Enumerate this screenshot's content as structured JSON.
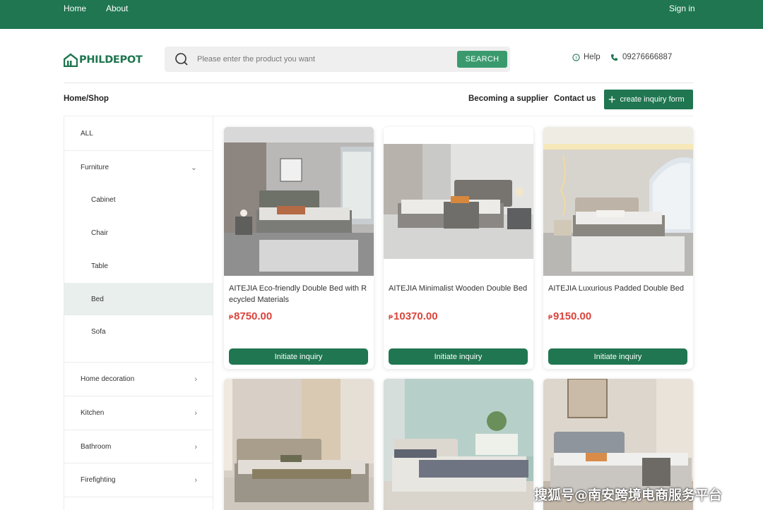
{
  "topbar": {
    "home": "Home",
    "about": "About",
    "sign_in": "Sign in"
  },
  "brand": {
    "logo_text": "PHILDEPOT",
    "color": "#1f7650"
  },
  "search": {
    "placeholder": "Please enter the product you want",
    "value": "",
    "button": "SEARCH"
  },
  "contact": {
    "help": "Help",
    "phone": "09276666887"
  },
  "breadcrumb": "Home/Shop",
  "nav": {
    "supplier": "Becoming a supplier",
    "contact_us": "Contact us",
    "inquiry_form": "create inquiry form"
  },
  "sidebar": {
    "items": [
      {
        "label": "ALL"
      },
      {
        "label": "Furniture",
        "expanded": true
      },
      {
        "label": "Cabinet"
      },
      {
        "label": "Chair"
      },
      {
        "label": "Table"
      },
      {
        "label": "Bed",
        "active": true
      },
      {
        "label": "Sofa"
      },
      {
        "label": "Home decoration"
      },
      {
        "label": "Kitchen"
      },
      {
        "label": "Bathroom"
      },
      {
        "label": "Firefighting"
      }
    ]
  },
  "products": [
    {
      "title": "AITEJIA Eco-friendly Double Bed with Recycled Materials",
      "currency": "₱",
      "price": "8750.00",
      "button": "Initiate inquiry"
    },
    {
      "title": "AITEJIA Minimalist Wooden Double Bed",
      "currency": "₱",
      "price": "10370.00",
      "button": "Initiate inquiry"
    },
    {
      "title": "AITEJIA Luxurious Padded Double Bed",
      "currency": "₱",
      "price": "9150.00",
      "button": "Initiate inquiry"
    },
    {
      "title": "",
      "currency": "",
      "price": "",
      "button": ""
    },
    {
      "title": "",
      "currency": "",
      "price": "",
      "button": ""
    },
    {
      "title": "",
      "currency": "",
      "price": "",
      "button": ""
    }
  ],
  "watermark": "搜狐号@南安跨境电商服务平台",
  "colors": {
    "primary": "#1f7650",
    "search_button": "#3a9a6e",
    "price": "#d9443b",
    "active_bg": "#e8efec"
  }
}
